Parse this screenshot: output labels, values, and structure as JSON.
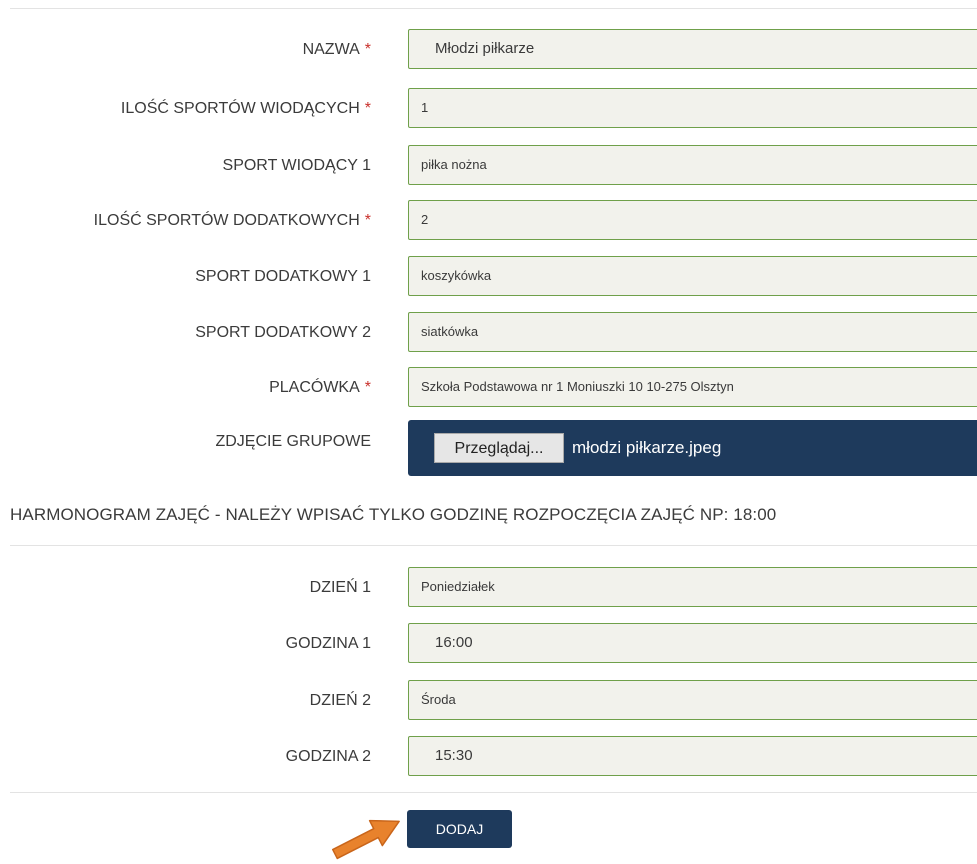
{
  "colors": {
    "required_marker": "#c9302c",
    "field_border": "#6fa04a",
    "field_background": "#f2f2ec",
    "primary_button": "#1e3a5c",
    "arrow": "#e8822c"
  },
  "form": {
    "required_marker": "*",
    "fields": {
      "nazwa": {
        "label": "NAZWA",
        "value": "Młodzi piłkarze"
      },
      "ilosc_wiodacych": {
        "label": "ILOŚĆ SPORTÓW WIODĄCYCH",
        "value": "1"
      },
      "sport_wiodacy_1": {
        "label": "SPORT WIODĄCY 1",
        "value": "piłka nożna"
      },
      "ilosc_dodatkowych": {
        "label": "ILOŚĆ SPORTÓW DODATKOWYCH",
        "value": "2"
      },
      "sport_dodatkowy_1": {
        "label": "SPORT DODATKOWY 1",
        "value": "koszykówka"
      },
      "sport_dodatkowy_2": {
        "label": "SPORT DODATKOWY 2",
        "value": "siatkówka"
      },
      "placowka": {
        "label": "PLACÓWKA",
        "value": "Szkoła Podstawowa nr 1 Moniuszki 10 10-275 Olsztyn"
      },
      "zdjecie": {
        "label": "ZDJĘCIE GRUPOWE",
        "button_label": "Przeglądaj...",
        "file_name": "młodzi piłkarze.jpeg"
      }
    }
  },
  "schedule": {
    "title": "HARMONOGRAM ZAJĘĆ - NALEŻY WPISAĆ TYLKO GODZINĘ ROZPOCZĘCIA ZAJĘĆ NP: 18:00",
    "dzien_1": {
      "label": "DZIEŃ 1",
      "value": "Poniedziałek"
    },
    "godzina_1": {
      "label": "GODZINA 1",
      "value": "16:00"
    },
    "dzien_2": {
      "label": "DZIEŃ 2",
      "value": "Środa"
    },
    "godzina_2": {
      "label": "GODZINA 2",
      "value": "15:30"
    }
  },
  "submit": {
    "label": "DODAJ"
  },
  "icons": {
    "pointer": "arrow-icon"
  }
}
